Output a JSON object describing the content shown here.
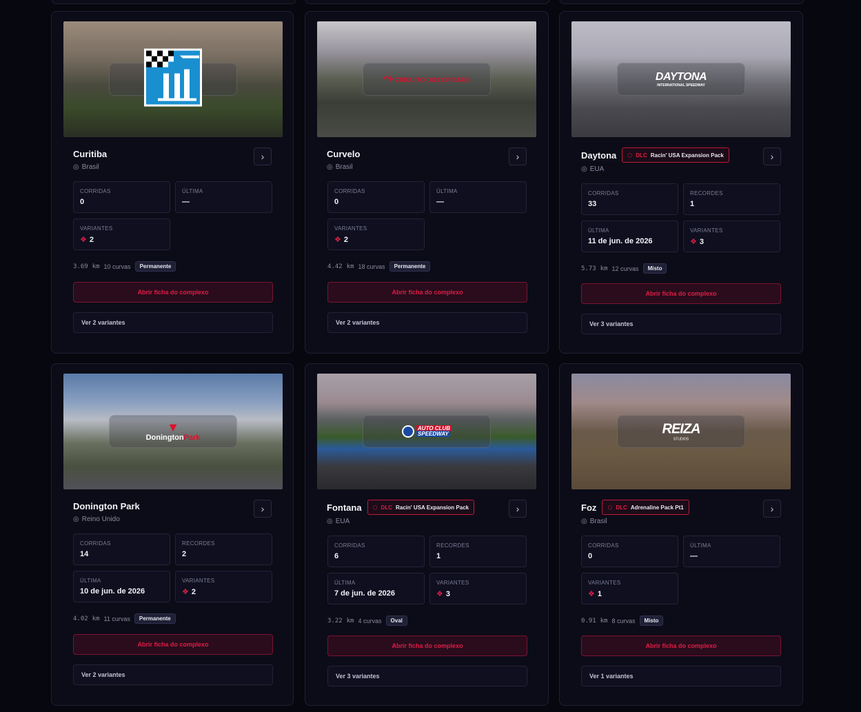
{
  "labels": {
    "corridas": "CORRIDAS",
    "ultima": "ÚLTIMA",
    "recordes": "RECORDES",
    "variantes": "VARIANTES",
    "open_button": "Abrir ficha do complexo",
    "dlc_tag": "DLC"
  },
  "colors": {
    "accent": "#e01c45",
    "background": "#07070f",
    "card": "#0c0c18"
  },
  "icons": {
    "country": "map-pin-icon",
    "variants": "layers-icon",
    "dlc": "package-icon",
    "open": "chevron-right-icon"
  },
  "tracks": [
    {
      "name": "Curitiba",
      "country": "Brasil",
      "dlc": "",
      "corridas": "0",
      "ultima": "—",
      "recordes": "",
      "variantes": "2",
      "length": "3.69",
      "unit": "km",
      "curves": "10 curvas",
      "type": "Permanente",
      "variants_button": "Ver 2 variantes",
      "logo_text": ""
    },
    {
      "name": "Curvelo",
      "country": "Brasil",
      "dlc": "",
      "corridas": "0",
      "ultima": "—",
      "recordes": "",
      "variantes": "2",
      "length": "4.42",
      "unit": "km",
      "curves": "18 curvas",
      "type": "Permanente",
      "variants_button": "Ver 2 variantes",
      "logo_text": "CIRCUITO DOS CRISTAIS"
    },
    {
      "name": "Daytona",
      "country": "EUA",
      "dlc": "Racin' USA Expansion Pack",
      "corridas": "33",
      "ultima": "11 de jun. de 2026",
      "recordes": "1",
      "variantes": "3",
      "length": "5.73",
      "unit": "km",
      "curves": "12 curvas",
      "type": "Misto",
      "variants_button": "Ver 3 variantes",
      "logo_text": "DAYTONA",
      "logo_sub": "INTERNATIONAL SPEEDWAY"
    },
    {
      "name": "Donington Park",
      "country": "Reino Unido",
      "dlc": "",
      "corridas": "14",
      "ultima": "10 de jun. de 2026",
      "recordes": "2",
      "variantes": "2",
      "length": "4.02",
      "unit": "km",
      "curves": "11 curvas",
      "type": "Permanente",
      "variants_button": "Ver 2 variantes",
      "logo_text": "Donington",
      "logo_sub": "Park"
    },
    {
      "name": "Fontana",
      "country": "EUA",
      "dlc": "Racin' USA Expansion Pack",
      "corridas": "6",
      "ultima": "7 de jun. de 2026",
      "recordes": "1",
      "variantes": "3",
      "length": "3.22",
      "unit": "km",
      "curves": "4 curvas",
      "type": "Oval",
      "variants_button": "Ver 3 variantes",
      "logo_text": "AUTO CLUB",
      "logo_sub": "SPEEDWAY"
    },
    {
      "name": "Foz",
      "country": "Brasil",
      "dlc": "Adrenaline Pack Pt1",
      "corridas": "0",
      "ultima": "—",
      "recordes": "",
      "variantes": "1",
      "length": "0.91",
      "unit": "km",
      "curves": "8 curvas",
      "type": "Misto",
      "variants_button": "Ver 1 variantes",
      "logo_text": "REIZA",
      "logo_sub": "STUDIOS"
    }
  ]
}
